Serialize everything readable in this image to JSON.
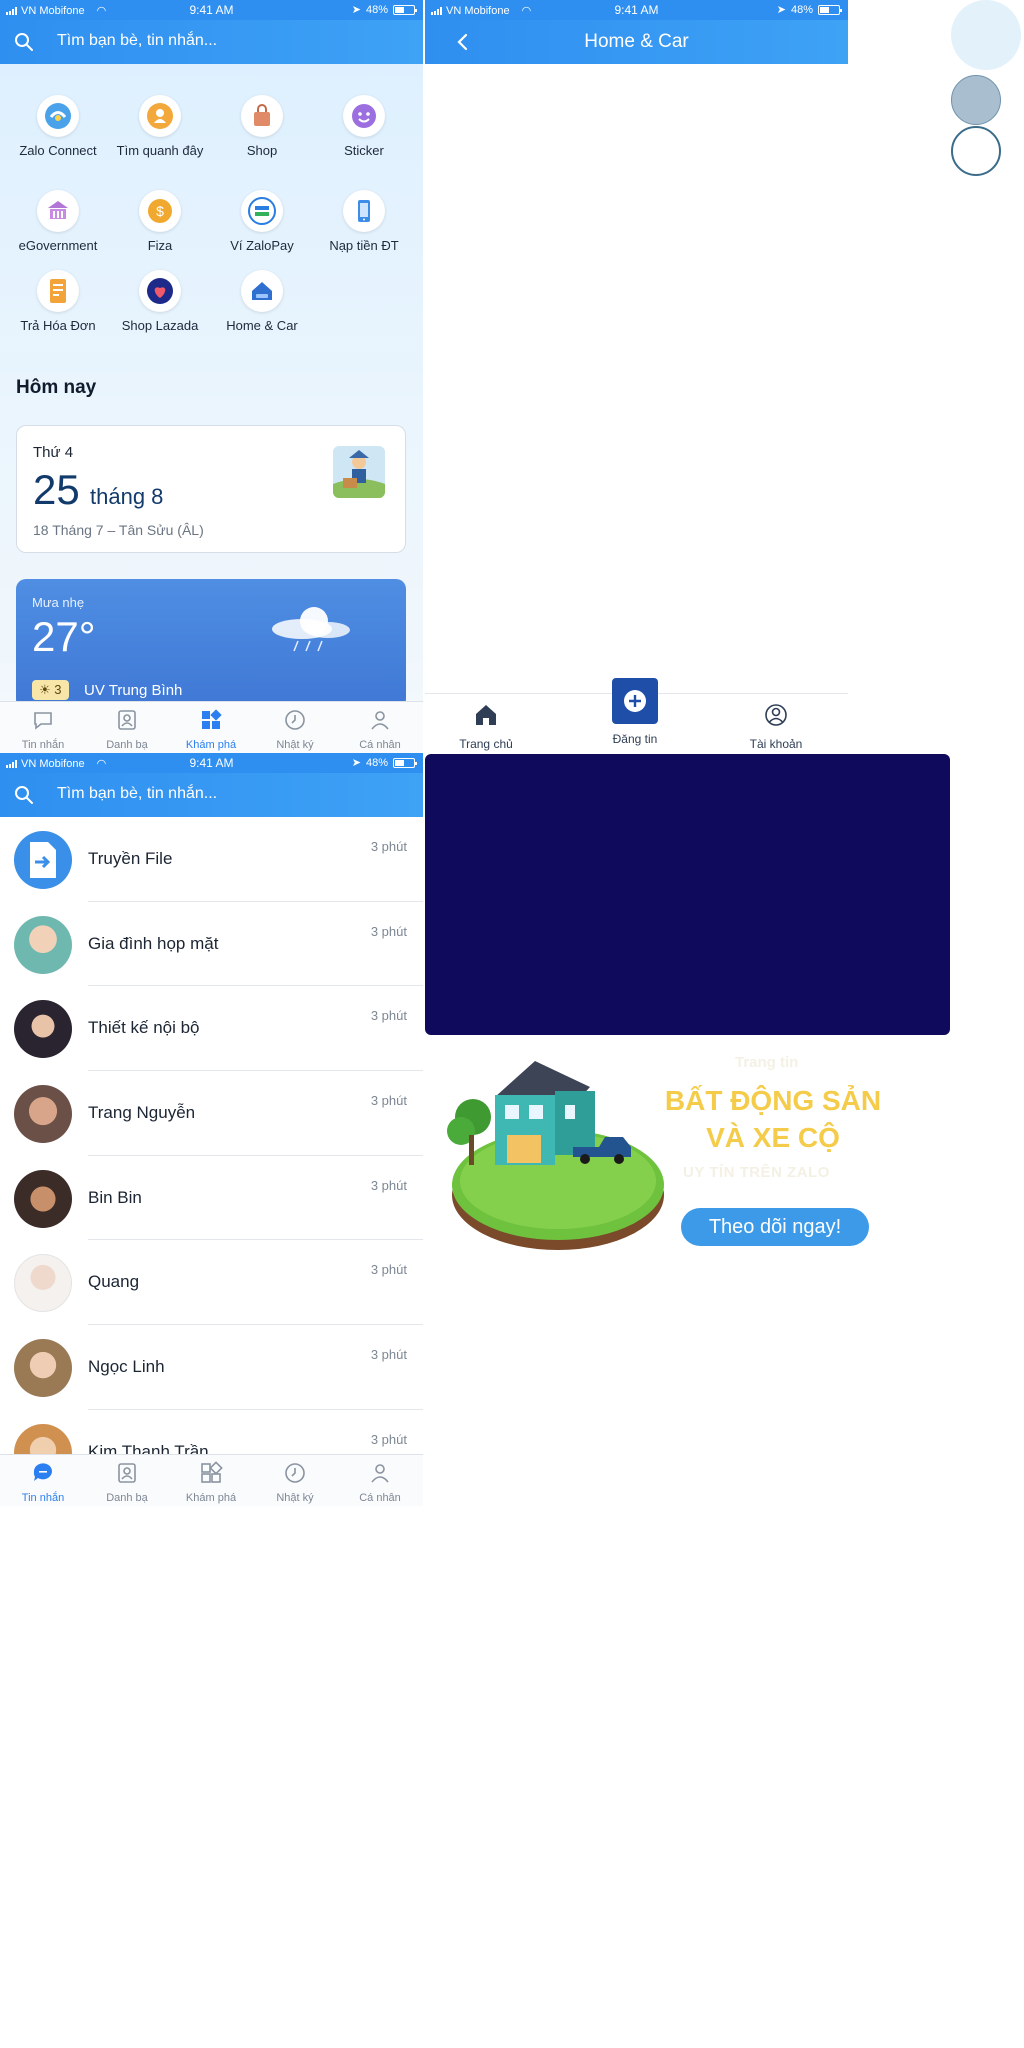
{
  "status_bar": {
    "carrier": "VN Mobifone",
    "time": "9:41 AM",
    "battery": "48%"
  },
  "search": {
    "placeholder": "Tìm bạn bè, tin nhắn..."
  },
  "discover": {
    "tiles": [
      {
        "label": "Zalo Connect",
        "icon": "zalo-connect-icon"
      },
      {
        "label": "Tìm quanh đây",
        "icon": "nearby-icon"
      },
      {
        "label": "Shop",
        "icon": "shop-bag-icon"
      },
      {
        "label": "Sticker",
        "icon": "sticker-icon"
      },
      {
        "label": "eGovernment",
        "icon": "egovernment-icon"
      },
      {
        "label": "Fiza",
        "icon": "fiza-coin-icon"
      },
      {
        "label": "Ví ZaloPay",
        "icon": "zalopay-icon"
      },
      {
        "label": "Nạp tiền ĐT",
        "icon": "phone-topup-icon"
      },
      {
        "label": "Trả Hóa Đơn",
        "icon": "bill-icon"
      },
      {
        "label": "Shop Lazada",
        "icon": "lazada-icon"
      },
      {
        "label": "Home & Car",
        "icon": "home-car-icon"
      }
    ],
    "section_title": "Hôm nay",
    "date_card": {
      "weekday": "Thứ 4",
      "day": "25",
      "month": "tháng 8",
      "lunar": "18 Tháng 7 – Tân Sửu (ÂL)"
    },
    "weather_card": {
      "condition": "Mưa nhẹ",
      "temperature": "27°",
      "uv_index": "3",
      "uv_label": "UV Trung Bình"
    }
  },
  "tabbar": {
    "items": [
      {
        "label": "Tin nhắn",
        "icon": "chat-bubble-icon"
      },
      {
        "label": "Danh bạ",
        "icon": "contacts-icon"
      },
      {
        "label": "Khám phá",
        "icon": "discover-grid-icon"
      },
      {
        "label": "Nhật ký",
        "icon": "clock-icon"
      },
      {
        "label": "Cá nhân",
        "icon": "person-icon"
      }
    ]
  },
  "messages": {
    "conversations": [
      {
        "name": "Truyền File",
        "time": "3 phút"
      },
      {
        "name": "Gia đình họp mặt",
        "time": "3 phút"
      },
      {
        "name": "Thiết kế nội bộ",
        "time": "3 phút"
      },
      {
        "name": "Trang Nguyễn",
        "time": "3 phút"
      },
      {
        "name": "Bin Bin",
        "time": "3 phút"
      },
      {
        "name": "Quang",
        "time": "3 phút"
      },
      {
        "name": "Ngọc Linh",
        "time": "3 phút"
      },
      {
        "name": "Kim Thanh Trần",
        "time": "3 phút"
      }
    ]
  },
  "home_car": {
    "title": "Home & Car",
    "tabs": [
      {
        "label": "Trang chủ",
        "icon": "home-icon"
      },
      {
        "label": "Đăng tin",
        "icon": "plus-circle-icon"
      },
      {
        "label": "Tài khoản",
        "icon": "account-icon"
      }
    ]
  },
  "promo": {
    "kicker": "Trang tin",
    "headline": "BẤT ĐỘNG SẢN VÀ XE CỘ",
    "subtitle": "UY TÍN TRÊN ZALO",
    "cta": "Theo dõi ngay!"
  },
  "colors": {
    "brand_blue": "#2f8ff0",
    "promo_navy": "#0f0a5c",
    "promo_gold": "#f4cc4a",
    "active_tab": "#2b7ff0"
  }
}
